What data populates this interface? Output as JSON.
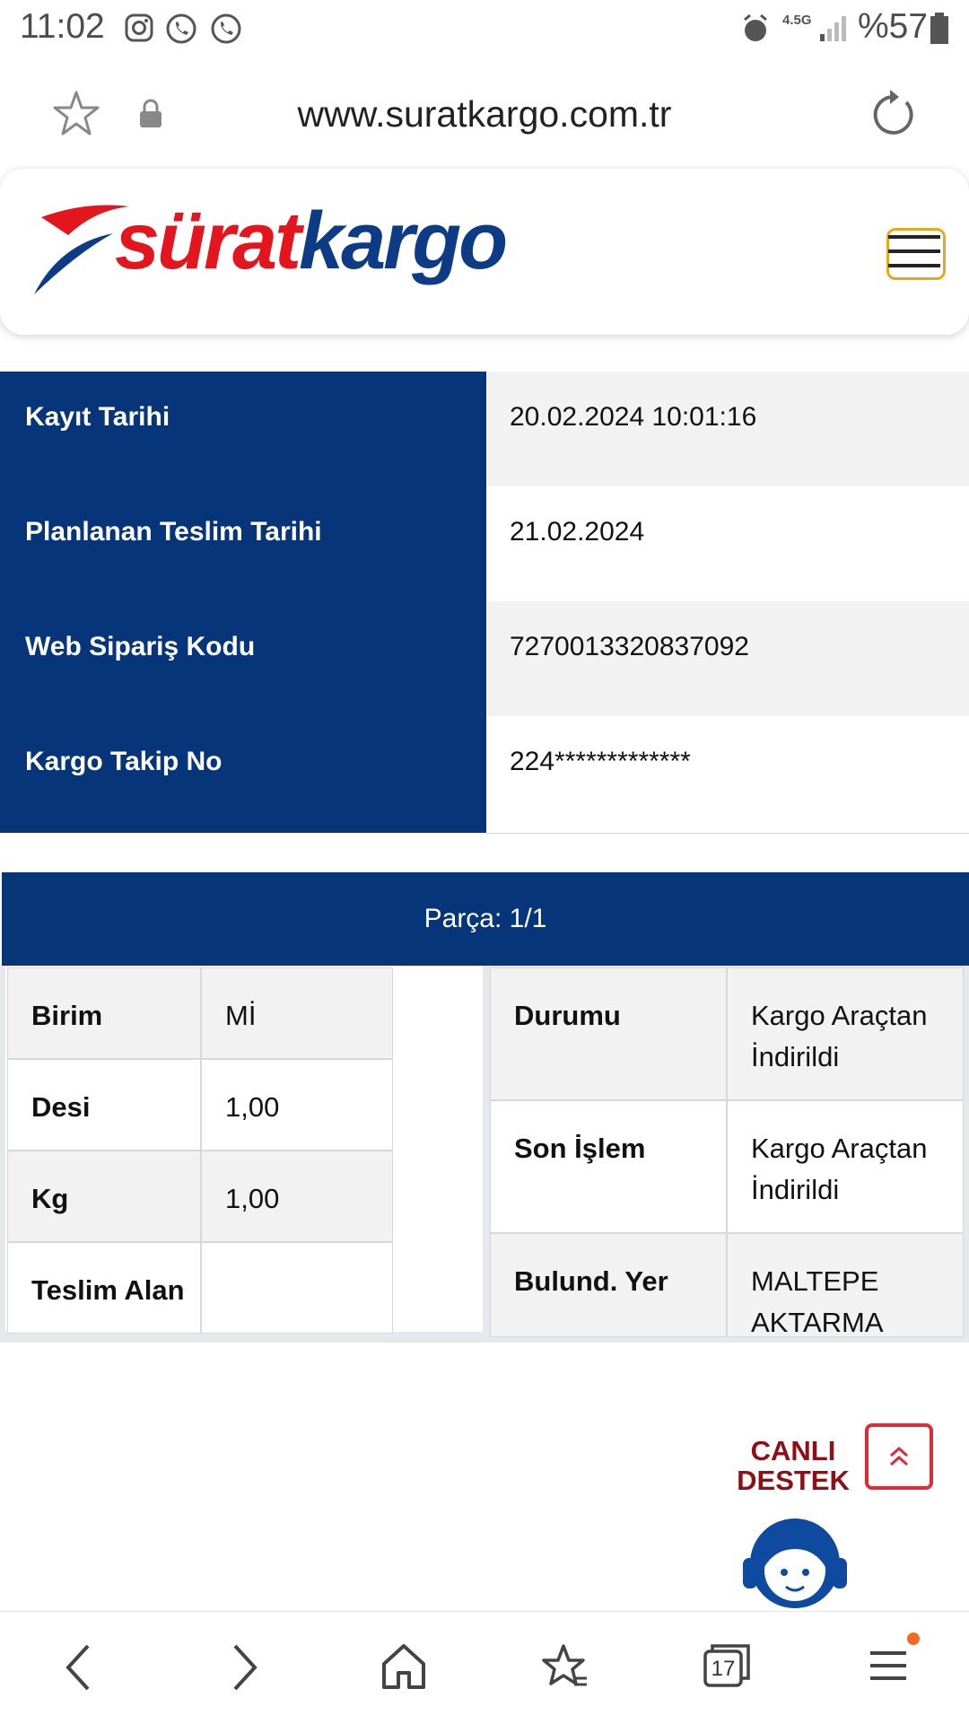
{
  "status_bar": {
    "time": "11:02",
    "network": "4.5G",
    "battery": "%57"
  },
  "browser": {
    "url": "www.suratkargo.com.tr",
    "tab_count": "17"
  },
  "brand": {
    "logo_part1": "sürat",
    "logo_part2": "kargo",
    "red": "#e3151d",
    "blue": "#0e3b86"
  },
  "info": [
    {
      "label": "Kayıt Tarihi",
      "value": "20.02.2024 10:01:16"
    },
    {
      "label": "Planlanan Teslim Tarihi",
      "value": "21.02.2024"
    },
    {
      "label": "Web Sipariş Kodu",
      "value": "7270013320837092"
    },
    {
      "label": "Kargo Takip No",
      "value": "224*************"
    }
  ],
  "parca": "Parça: 1/1",
  "left_table": [
    {
      "label": "Birim",
      "value": "Mİ"
    },
    {
      "label": "Desi",
      "value": "1,00"
    },
    {
      "label": "Kg",
      "value": "1,00"
    },
    {
      "label": "Teslim Alan",
      "value": ""
    }
  ],
  "right_table": [
    {
      "label": "Durumu",
      "value_line1": "Kargo Araçtan",
      "value_line2": "İndirildi"
    },
    {
      "label": "Son İşlem",
      "value_line1": "Kargo Araçtan",
      "value_line2": "İndirildi"
    },
    {
      "label": "Bulund. Yer",
      "value_line1": "MALTEPE",
      "value_line2": "AKTARMA"
    }
  ],
  "support": {
    "line1": "CANLI",
    "line2": "DESTEK",
    "up_icon": "chevrons-up-icon"
  },
  "colors": {
    "navy": "#073579",
    "support_red": "#8f0f16",
    "button_red": "#e02a35"
  }
}
